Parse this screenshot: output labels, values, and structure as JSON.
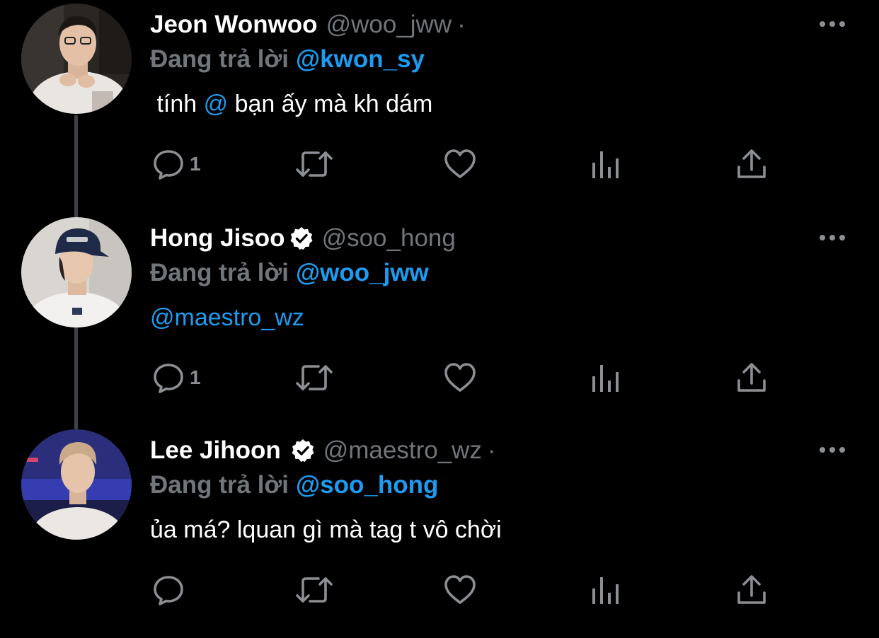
{
  "colors": {
    "background": "#000000",
    "text_primary": "#FFFFFF",
    "text_secondary": "#71767B",
    "link_blue": "#1D9BF0",
    "thread_line": "#3E4144",
    "icon_gray": "#8B8F94"
  },
  "tweets": [
    {
      "avatar_icon": "avatar-photo",
      "display_name": "Jeon Wonwoo",
      "verified": false,
      "handle": "@woo_jww",
      "dot": "·",
      "reply_prefix": "Đang trả lời",
      "reply_target": "@kwon_sy",
      "body_before": " tính ",
      "body_mention": "@",
      "body_after": " bạn ấy mà kh dám",
      "reply_count": "1",
      "icons": [
        "reply-icon",
        "retweet-icon",
        "like-icon",
        "analytics-icon",
        "share-icon",
        "more-icon"
      ]
    },
    {
      "avatar_icon": "avatar-photo",
      "display_name": "Hong Jisoo",
      "verified": true,
      "handle": "@soo_hong",
      "dot": "",
      "reply_prefix": "Đang trả lời",
      "reply_target": "@woo_jww",
      "body_before": "",
      "body_mention": "@maestro_wz",
      "body_after": "",
      "reply_count": "1",
      "icons": [
        "reply-icon",
        "retweet-icon",
        "like-icon",
        "analytics-icon",
        "share-icon",
        "more-icon"
      ]
    },
    {
      "avatar_icon": "avatar-photo",
      "display_name": "Lee Jihoon",
      "verified": true,
      "handle": "@maestro_wz",
      "dot": "·",
      "reply_prefix": "Đang trả lời",
      "reply_target": "@soo_hong",
      "body_before": "ủa má? lquan gì mà tag t vô chời",
      "body_mention": "",
      "body_after": "",
      "reply_count": "",
      "icons": [
        "reply-icon",
        "retweet-icon",
        "like-icon",
        "analytics-icon",
        "share-icon",
        "more-icon"
      ]
    }
  ]
}
